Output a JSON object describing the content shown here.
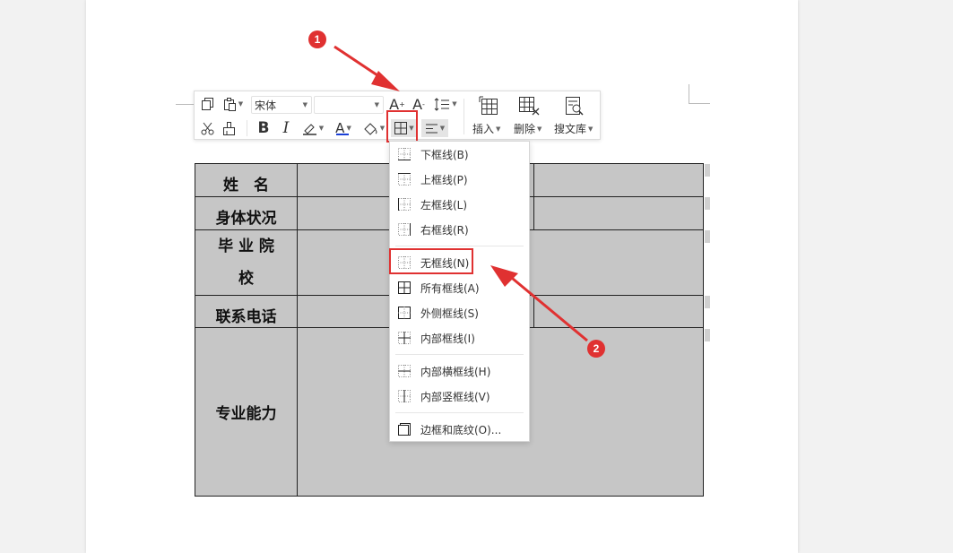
{
  "toolbar": {
    "font_name": "宋体",
    "font_size": "",
    "font_grow_label": "A",
    "font_shrink_label": "A",
    "bold_label": "B",
    "italic_label": "I",
    "font_color_label": "A",
    "insert_label": "插入",
    "delete_label": "删除",
    "search_lib_label": "搜文库"
  },
  "border_menu": {
    "items": [
      {
        "label": "下框线(B)",
        "icon": "bottom-border-icon"
      },
      {
        "label": "上框线(P)",
        "icon": "top-border-icon"
      },
      {
        "label": "左框线(L)",
        "icon": "left-border-icon"
      },
      {
        "label": "右框线(R)",
        "icon": "right-border-icon"
      },
      {
        "label": "无框线(N)",
        "icon": "no-border-icon",
        "highlighted": true
      },
      {
        "label": "所有框线(A)",
        "icon": "all-borders-icon"
      },
      {
        "label": "外侧框线(S)",
        "icon": "outside-borders-icon"
      },
      {
        "label": "内部框线(I)",
        "icon": "inside-borders-icon"
      },
      {
        "label": "内部横框线(H)",
        "icon": "inside-horizontal-border-icon"
      },
      {
        "label": "内部竖框线(V)",
        "icon": "inside-vertical-border-icon"
      },
      {
        "label": "边框和底纹(O)...",
        "icon": "borders-and-shading-icon"
      }
    ]
  },
  "table": {
    "rows": [
      {
        "label": "姓　名"
      },
      {
        "label": "身体状况"
      },
      {
        "label_line1": "毕 业 院",
        "label_line2": "校"
      },
      {
        "label": "联系电话"
      },
      {
        "label": "专业能力"
      }
    ]
  },
  "annotations": {
    "step1": "1",
    "step2": "2"
  },
  "colors": {
    "accent_red": "#e03131",
    "table_fill": "#c6c6c6",
    "font_color_underline": "#1a3fd6"
  }
}
